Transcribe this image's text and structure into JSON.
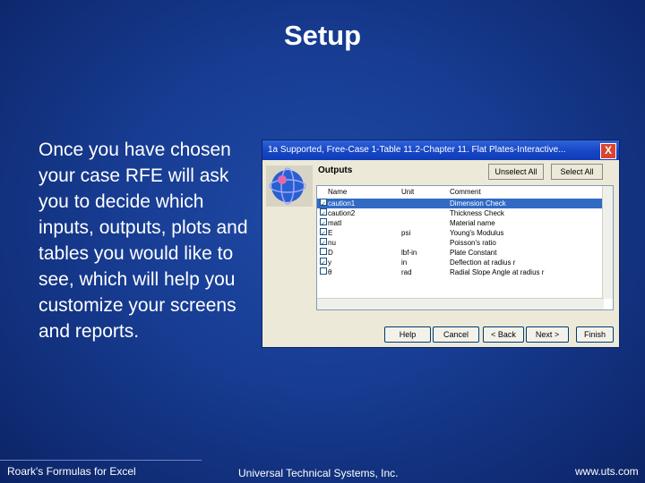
{
  "slide": {
    "title": "Setup",
    "body": "Once you have chosen your case RFE will ask you to decide which inputs, outputs, plots and tables you would like to see, which will help you customize your screens and reports."
  },
  "dialog": {
    "title": "1a Supported, Free-Case 1-Table 11.2-Chapter 11. Flat Plates-Interactive...",
    "close_label": "X",
    "section_label": "Outputs",
    "toolbar": {
      "unselect_all": "Unselect All",
      "select_all": "Select All"
    },
    "columns": [
      "Name",
      "Unit",
      "Comment"
    ],
    "rows": [
      {
        "checked": "✓",
        "name": "caution1",
        "unit": "",
        "comment": "Dimension Check"
      },
      {
        "checked": "✓",
        "name": "caution2",
        "unit": "",
        "comment": "Thickness Check"
      },
      {
        "checked": "✓",
        "name": "matl",
        "unit": "",
        "comment": "Material name"
      },
      {
        "checked": "✓",
        "name": "E",
        "unit": "psi",
        "comment": "Young's Modulus"
      },
      {
        "checked": "✓",
        "name": "nu",
        "unit": "",
        "comment": "Poisson's ratio"
      },
      {
        "checked": "",
        "name": "D",
        "unit": "lbf-in",
        "comment": "Plate Constant"
      },
      {
        "checked": "✓",
        "name": "y",
        "unit": "in",
        "comment": "Deflection at radius r"
      },
      {
        "checked": "",
        "name": "θ",
        "unit": "rad",
        "comment": "Radial Slope Angle at radius r"
      }
    ],
    "buttons": {
      "help": "Help",
      "cancel": "Cancel",
      "back": "< Back",
      "next": "Next >",
      "finish": "Finish"
    },
    "accent": "#1848c8"
  },
  "footer": {
    "left": "Roark's Formulas for Excel",
    "center": "Universal Technical Systems, Inc.",
    "right": "www.uts.com"
  }
}
